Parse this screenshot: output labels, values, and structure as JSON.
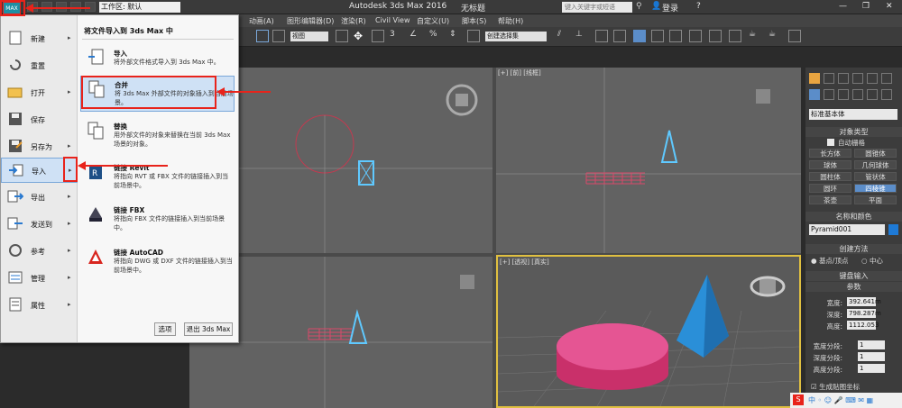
{
  "title_bar": {
    "app_title": "Autodesk 3ds Max 2016",
    "doc_title": "无标题",
    "workspace_label": "工作区: 默认",
    "search_placeholder": "键入关键字或短语",
    "user_label": "登录",
    "app_logo": "MAX"
  },
  "menu_bar": {
    "items": [
      "动画(A)",
      "图形编辑器(D)",
      "渲染(R)",
      "Civil View",
      "自定义(U)",
      "脚本(S)",
      "帮助(H)"
    ]
  },
  "toolbar": {
    "view_dropdown": "视图",
    "selection_set_placeholder": "创建选择集"
  },
  "app_menu": {
    "left_items": [
      {
        "label": "新建",
        "icon": "new-icon",
        "has_arrow": true
      },
      {
        "label": "重置",
        "icon": "reset-icon",
        "has_arrow": false
      },
      {
        "label": "打开",
        "icon": "open-icon",
        "has_arrow": true
      },
      {
        "label": "保存",
        "icon": "save-icon",
        "has_arrow": false
      },
      {
        "label": "另存为",
        "icon": "save-as-icon",
        "has_arrow": true
      },
      {
        "label": "导入",
        "icon": "import-icon",
        "has_arrow": true
      },
      {
        "label": "导出",
        "icon": "export-icon",
        "has_arrow": true
      },
      {
        "label": "发送到",
        "icon": "send-to-icon",
        "has_arrow": true
      },
      {
        "label": "参考",
        "icon": "reference-icon",
        "has_arrow": true
      },
      {
        "label": "管理",
        "icon": "manage-icon",
        "has_arrow": true
      },
      {
        "label": "属性",
        "icon": "properties-icon",
        "has_arrow": true
      }
    ],
    "selected_left": "导入",
    "panel_title": "将文件导入到 3ds Max 中",
    "right_items": [
      {
        "title": "导入",
        "desc": "将外部文件格式导入到 3ds Max 中。",
        "icon": "import-file-icon"
      },
      {
        "title": "合并",
        "desc": "将 3ds Max 外部文件的对象插入到当前场景。",
        "icon": "merge-icon"
      },
      {
        "title": "替换",
        "desc": "用外部文件的对象来替换在当前 3ds Max 场景的对象。",
        "icon": "replace-icon"
      },
      {
        "title": "链接 Revit",
        "desc": "将指向 RVT 或 FBX 文件的链接插入到当前场景中。",
        "icon": "revit-icon"
      },
      {
        "title": "链接 FBX",
        "desc": "将指向 FBX 文件的链接插入到当前场景中。",
        "icon": "fbx-icon"
      },
      {
        "title": "链接 AutoCAD",
        "desc": "将指向 DWG 或 DXF 文件的链接插入到当前场景中。",
        "icon": "autocad-icon"
      }
    ],
    "options_button": "选项",
    "exit_button": "退出 3ds Max"
  },
  "viewports": {
    "front_label": "[+] [前] [线框]",
    "perspective_label": "[+] [透视] [真实]"
  },
  "command_panel": {
    "category_dropdown": "标准基本体",
    "object_type_header": "对象类型",
    "auto_grid_label": "自动栅格",
    "object_buttons": [
      "长方体",
      "圆锥体",
      "球体",
      "几何球体",
      "圆柱体",
      "管状体",
      "圆环",
      "四棱锥",
      "茶壶",
      "平面"
    ],
    "active_object": "四棱锥",
    "name_color_header": "名称和颜色",
    "object_name": "Pyramid001",
    "object_color": "#1e7ad6",
    "creation_method_header": "创建方法",
    "creation_options": [
      "基点/顶点",
      "中心"
    ],
    "keyboard_entry_header": "键盘输入",
    "parameters_header": "参数",
    "params": [
      {
        "label": "宽度:",
        "value": "392.641m"
      },
      {
        "label": "深度:",
        "value": "798.287m"
      },
      {
        "label": "高度:",
        "value": "1112.053"
      }
    ],
    "segments": [
      {
        "label": "宽度分段:",
        "value": "1"
      },
      {
        "label": "深度分段:",
        "value": "1"
      },
      {
        "label": "高度分段:",
        "value": "1"
      }
    ],
    "gen_mapping_label": "生成贴图坐标"
  },
  "colors": {
    "accent_red": "#e8231b",
    "selection_blue": "#5b8dc9",
    "cylinder_pink": "#e0407f",
    "pyramid_blue": "#2a8fd8"
  }
}
